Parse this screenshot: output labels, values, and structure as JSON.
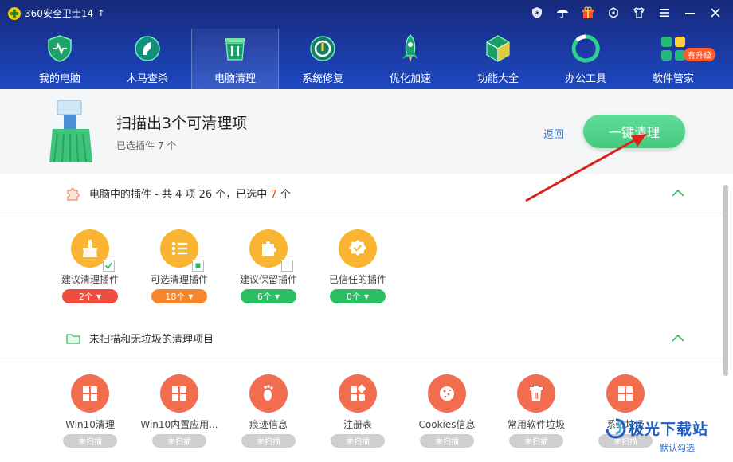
{
  "app": {
    "title": "360安全卫士14",
    "update_arrow": "↑"
  },
  "window_controls": [
    "shield-icon",
    "umbrella-icon",
    "gift-icon",
    "refresh-icon",
    "skin-icon",
    "menu-icon",
    "minimize-icon",
    "close-icon"
  ],
  "nav": {
    "items": [
      {
        "label": "我的电脑",
        "icon": "shield-pulse-icon"
      },
      {
        "label": "木马查杀",
        "icon": "horse-icon"
      },
      {
        "label": "电脑清理",
        "icon": "trash-icon",
        "active": true
      },
      {
        "label": "系统修复",
        "icon": "repair-icon"
      },
      {
        "label": "优化加速",
        "icon": "rocket-icon"
      },
      {
        "label": "功能大全",
        "icon": "cube-icon"
      },
      {
        "label": "办公工具",
        "icon": "ring-icon"
      },
      {
        "label": "软件管家",
        "icon": "apps-icon",
        "badge": "有升级"
      }
    ]
  },
  "summary": {
    "title": "扫描出3个可清理项",
    "subtitle": "已选插件 7 个",
    "back": "返回",
    "clean_button": "一键清理"
  },
  "plugins_section": {
    "title_prefix": "电脑中的插件 - 共 4 项 26 个，已选中 ",
    "selected": "7",
    "title_suffix": " 个",
    "cards": [
      {
        "label": "建议清理插件",
        "count": "2个",
        "checked": "checked"
      },
      {
        "label": "可选清理插件",
        "count": "18个",
        "checked": "partial"
      },
      {
        "label": "建议保留插件",
        "count": "6个",
        "checked": "unchecked"
      },
      {
        "label": "已信任的插件",
        "count": "0个",
        "checked": "none"
      }
    ]
  },
  "unscanned_section": {
    "title": "未扫描和无垃圾的清理项目",
    "status": "未扫描",
    "cards": [
      {
        "label": "Win10清理"
      },
      {
        "label": "Win10内置应用..."
      },
      {
        "label": "痕迹信息"
      },
      {
        "label": "注册表"
      },
      {
        "label": "Cookies信息"
      },
      {
        "label": "常用软件垃圾"
      },
      {
        "label": "系统垃圾"
      }
    ]
  },
  "watermark": {
    "text": "极光下载站",
    "sub": "默认勾选"
  },
  "colors": {
    "header": "#1b3aa3",
    "accent_green": "#45c97f",
    "plugin_yellow": "#f9b531",
    "clean_red": "#f26c4f",
    "selected_highlight": "#e64a2a"
  }
}
